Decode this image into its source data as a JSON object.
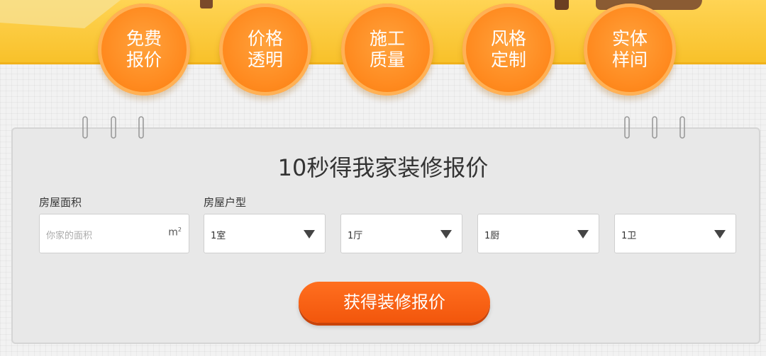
{
  "features": [
    {
      "line1": "免费",
      "line2": "报价"
    },
    {
      "line1": "价格",
      "line2": "透明"
    },
    {
      "line1": "施工",
      "line2": "质量"
    },
    {
      "line1": "风格",
      "line2": "定制"
    },
    {
      "line1": "实体",
      "line2": "样间"
    }
  ],
  "form": {
    "title": "10秒得我家装修报价",
    "area_label": "房屋面积",
    "layout_label": "房屋户型",
    "area_placeholder": "你家的面积",
    "area_unit": "m",
    "area_unit_sup": "2",
    "rooms": "1室",
    "halls": "1厅",
    "kitchens": "1厨",
    "baths": "1卫",
    "submit_label": "获得装修报价"
  },
  "colors": {
    "banner": "#f8c12a",
    "circle": "#ff8a1f",
    "button": "#f2560c"
  },
  "icons": [
    "binder-ring-icon",
    "dropdown-caret-icon"
  ]
}
